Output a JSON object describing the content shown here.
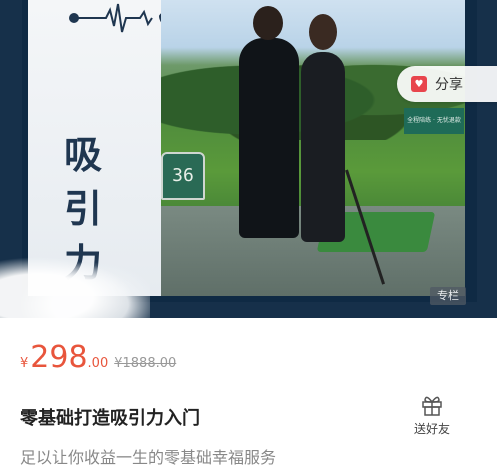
{
  "banner": {
    "title_chars": [
      "吸",
      "引",
      "力"
    ],
    "photo_sign": "36",
    "billboard_text": "全程陪练 · 无忧退款",
    "share_label": "分享",
    "column_tag": "专栏"
  },
  "product": {
    "currency": "¥",
    "price_int": "298",
    "price_dec": ".00",
    "original_price": "¥1888.00",
    "title": "零基础打造吸引力入门",
    "subtitle": "足以让你收益一生的零基础幸福服务"
  },
  "actions": {
    "gift_label": "送好友"
  },
  "colors": {
    "price": "#e8553c",
    "share_icon": "#e8454d",
    "banner_dark": "#0f2a44"
  }
}
